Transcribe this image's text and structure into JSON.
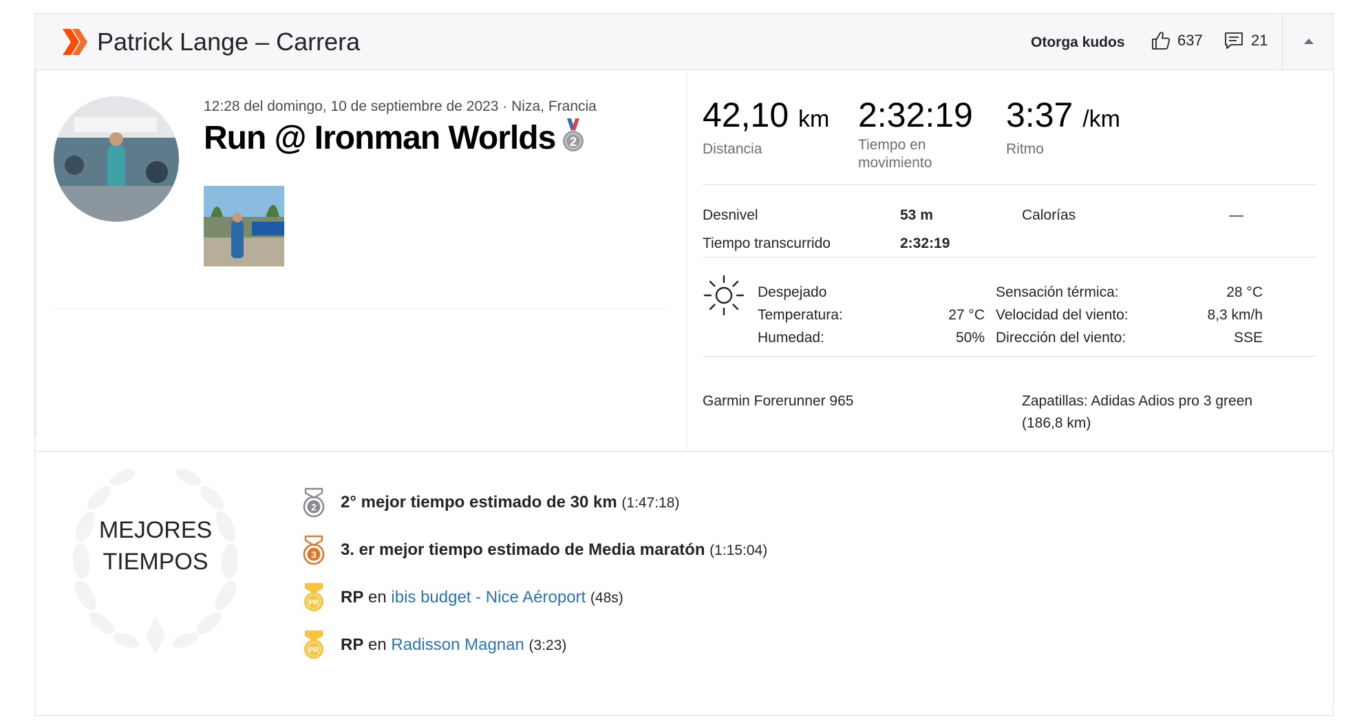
{
  "header": {
    "athlete_title": "Patrick Lange – Carrera",
    "kudos_label": "Otorga kudos",
    "kudos_count": "637",
    "comments_count": "21",
    "colors": {
      "brand": "#fc4c02",
      "text": "#242428",
      "muted": "#6d6d78",
      "link": "#2d73b4"
    }
  },
  "activity": {
    "meta": "12:28 del domingo, 10 de septiembre de 2023 · Niza, Francia",
    "title": "Run @ Ironman Worlds",
    "title_medal_rank": "2"
  },
  "stats": {
    "distance": {
      "value": "42,10",
      "unit": "km",
      "label": "Distancia"
    },
    "moving_time": {
      "value": "2:32:19",
      "label_line1": "Tiempo en",
      "label_line2": "movimiento"
    },
    "pace": {
      "value": "3:37",
      "unit": "/km",
      "label": "Ritmo"
    },
    "elevation": {
      "label": "Desnivel",
      "value": "53 m"
    },
    "calories": {
      "label": "Calorías",
      "value": "—"
    },
    "elapsed": {
      "label": "Tiempo transcurrido",
      "value": "2:32:19"
    }
  },
  "weather": {
    "icon": "sun-icon",
    "condition": "Despejado",
    "temperature_label": "Temperatura:",
    "temperature_value": "27 °C",
    "humidity_label": "Humedad:",
    "humidity_value": "50%",
    "feels_like_label": "Sensación térmica:",
    "feels_like_value": "28 °C",
    "wind_speed_label": "Velocidad del viento:",
    "wind_speed_value": "8,3 km/h",
    "wind_dir_label": "Dirección del viento:",
    "wind_dir_value": "SSE"
  },
  "gear": {
    "device": "Garmin Forerunner 965",
    "shoes_line1": "Zapatillas: Adidas Adios pro 3 green",
    "shoes_line2": "(186,8 km)"
  },
  "achievements": {
    "heading_line1": "MEJORES",
    "heading_line2": "TIEMPOS",
    "items": [
      {
        "icon": "silver-medal-icon",
        "rank": "2",
        "bold": "2° mejor tiempo estimado de 30 km",
        "time": "(1:47:18)"
      },
      {
        "icon": "bronze-medal-icon",
        "rank": "3",
        "bold": "3. er mejor tiempo estimado de Media maratón",
        "time": "(1:15:04)"
      },
      {
        "icon": "pr-medal-icon",
        "badge": "PR",
        "bold": "RP",
        "connector": "en",
        "link": "ibis budget - Nice Aéroport",
        "time": "(48s)"
      },
      {
        "icon": "pr-medal-icon",
        "badge": "PR",
        "bold": "RP",
        "connector": "en",
        "link": "Radisson Magnan",
        "time": "(3:23)"
      }
    ]
  }
}
